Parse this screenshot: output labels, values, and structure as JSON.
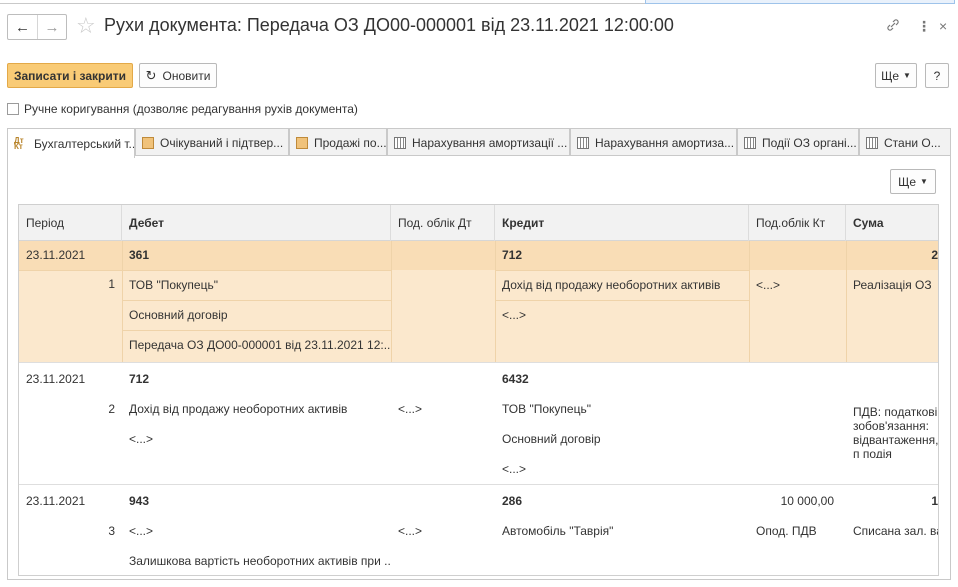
{
  "window": {
    "title": "Рухи документа: Передача ОЗ ДО00-000001 від 23.11.2021 12:00:00"
  },
  "toolbar": {
    "save_close_label": "Записати і закрити",
    "refresh_label": "Оновити",
    "more_label": "Ще",
    "help_label": "?"
  },
  "manual_correction": {
    "label": "Ручне коригування (дозволяє редагування рухів документа)",
    "checked": false
  },
  "tabs": [
    {
      "label": "Бухгалтерський т...",
      "icon": "accounting-register-icon",
      "active": true
    },
    {
      "label": "Очікуваний і підтвер...",
      "icon": "register-doc-icon",
      "active": false
    },
    {
      "label": "Продажі по...",
      "icon": "register-doc-icon",
      "active": false
    },
    {
      "label": "Нарахування амортизації ...",
      "icon": "calculation-register-icon",
      "active": false
    },
    {
      "label": "Нарахування амортиза...",
      "icon": "calculation-register-icon",
      "active": false
    },
    {
      "label": "Події ОЗ органі...",
      "icon": "calculation-register-icon",
      "active": false
    },
    {
      "label": "Стани О...",
      "icon": "calculation-register-icon",
      "active": false
    }
  ],
  "panel": {
    "more_label": "Ще"
  },
  "table": {
    "columns": {
      "period": "Період",
      "debit": "Дебет",
      "analytics_dt": "Под. облік Дт",
      "credit": "Кредит",
      "analytics_kt": "Под.облік Кт",
      "amount": "Сума"
    },
    "rows": [
      {
        "period": "23.11.2021",
        "number": "1",
        "debit_account": "361",
        "debit_sub": [
          "ТОВ \"Покупець\"",
          "Основний договір",
          "Передача ОЗ ДО00-000001 від 23.11.2021 12:..."
        ],
        "analytics_dt": "",
        "credit_account": "712",
        "credit_sub": [
          "Дохід від продажу необоротних активів",
          "<...>"
        ],
        "analytics_kt": "<...>",
        "amount": "2",
        "content": "Реалізація ОЗ"
      },
      {
        "period": "23.11.2021",
        "number": "2",
        "debit_account": "712",
        "debit_sub": [
          "Дохід від продажу необоротних активів",
          "<...>"
        ],
        "analytics_dt": "<...>",
        "credit_account": "6432",
        "credit_sub": [
          "ТОВ \"Покупець\"",
          "Основний договір",
          "<...>"
        ],
        "analytics_kt": "",
        "amount": "",
        "content": "ПДВ: податкові зобов'язання: відвантаження, п подія"
      },
      {
        "period": "23.11.2021",
        "number": "3",
        "debit_account": "943",
        "debit_sub": [
          "<...>",
          "Залишкова вартість необоротних активів при ..."
        ],
        "analytics_dt": "<...>",
        "credit_account": "286",
        "credit_sub": [
          "Автомобіль \"Таврія\""
        ],
        "credit_value": "10 000,00",
        "analytics_kt": "Опод. ПДВ",
        "amount": "1",
        "content": "Списана зал. вар"
      }
    ]
  },
  "colors": {
    "primary_button": "#f9cb76",
    "selected_row": "#fbe8cd",
    "header_bg": "#f2f2f2"
  }
}
